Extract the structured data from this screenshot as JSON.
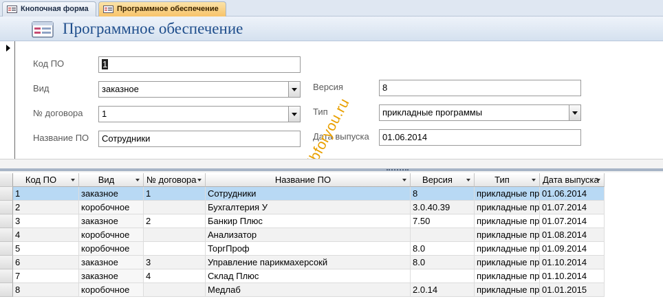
{
  "tabs": [
    {
      "label": "Кнопочная форма",
      "active": false
    },
    {
      "label": "Программное обеспечение",
      "active": true
    }
  ],
  "header": {
    "title": "Программное обеспечение"
  },
  "form": {
    "kod_label": "Код ПО",
    "kod_value": "1",
    "vid_label": "Вид",
    "vid_value": "заказное",
    "dogovor_label": "№ договора",
    "dogovor_value": "1",
    "nazvanie_label": "Название ПО",
    "nazvanie_value": "Сотрудники",
    "versia_label": "Версия",
    "versia_value": "8",
    "tip_label": "Тип",
    "tip_value": "прикладные программы",
    "data_label": "Дата выпуска",
    "data_value": "01.06.2014"
  },
  "watermark": "dbforyou.ru",
  "grid": {
    "columns": [
      "Код ПО",
      "Вид",
      "№ договора",
      "Название ПО",
      "Версия",
      "Тип",
      "Дата выпуска"
    ],
    "rows": [
      [
        "1",
        "заказное",
        "1",
        "Сотрудники",
        "8",
        "прикладные программы",
        "01.06.2014"
      ],
      [
        "2",
        "коробочное",
        "",
        "Бухгалтерия У",
        "3.0.40.39",
        "прикладные программы",
        "01.07.2014"
      ],
      [
        "3",
        "заказное",
        "2",
        "Банкир Плюс",
        "7.50",
        "прикладные программы",
        "01.07.2014"
      ],
      [
        "4",
        "коробочное",
        "",
        "Анализатор",
        "",
        "прикладные программы",
        "01.08.2014"
      ],
      [
        "5",
        "коробочное",
        "",
        "ТоргПроф",
        "8.0",
        "прикладные программы",
        "01.09.2014"
      ],
      [
        "6",
        "заказное",
        "3",
        "Управление парикмахерсокй",
        "8.0",
        "прикладные программы",
        "01.10.2014"
      ],
      [
        "7",
        "заказное",
        "4",
        "Склад Плюс",
        "",
        "прикладные программы",
        "01.10.2014"
      ],
      [
        "8",
        "коробочное",
        "",
        "Медлаб",
        "2.0.14",
        "прикладные программы",
        "01.01.2015"
      ]
    ]
  },
  "colors": {
    "accent_title": "#1f4e8c",
    "active_tab": "#f7c36a",
    "current_row": "#b8d9f4",
    "watermark": "#e9a000"
  }
}
